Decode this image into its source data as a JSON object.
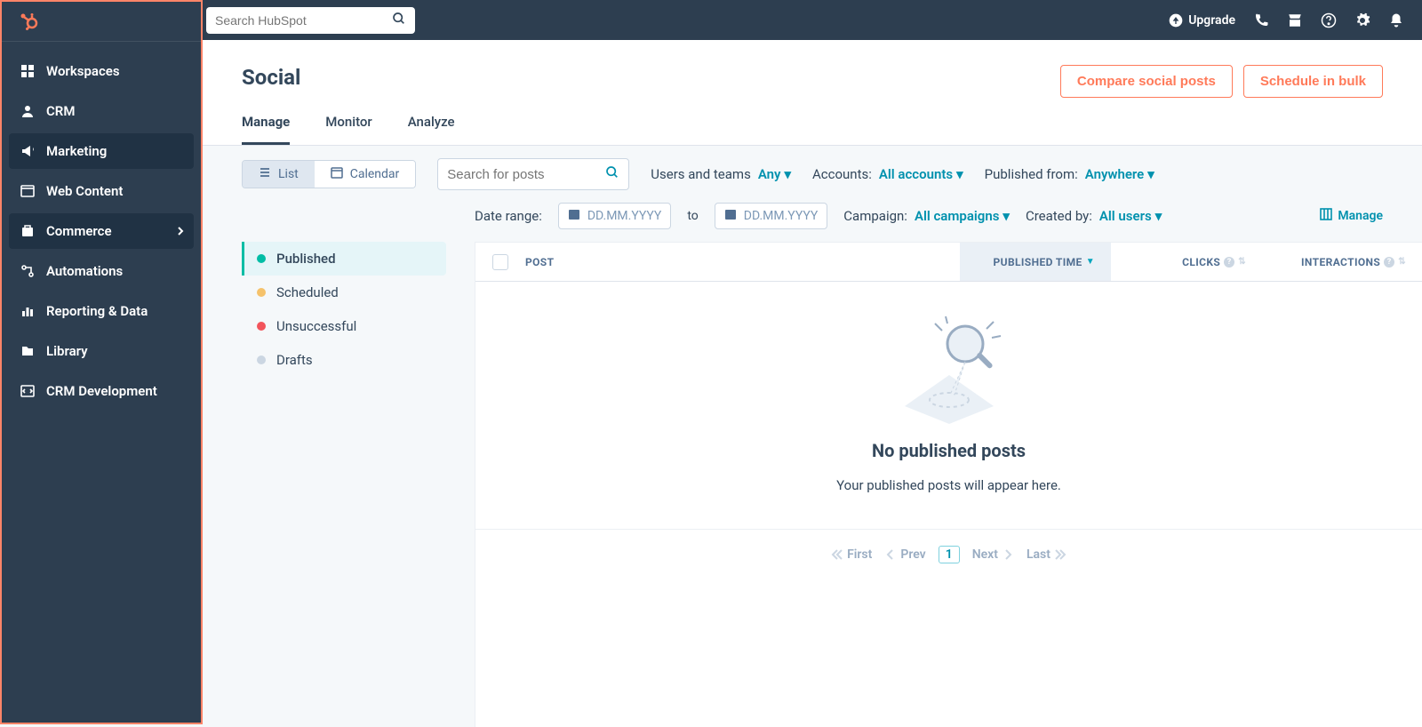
{
  "globalSearch": {
    "placeholder": "Search HubSpot"
  },
  "topbar": {
    "upgrade": "Upgrade"
  },
  "sidebar": {
    "items": [
      {
        "label": "Workspaces"
      },
      {
        "label": "CRM"
      },
      {
        "label": "Marketing"
      },
      {
        "label": "Web Content"
      },
      {
        "label": "Commerce"
      },
      {
        "label": "Automations"
      },
      {
        "label": "Reporting & Data"
      },
      {
        "label": "Library"
      },
      {
        "label": "CRM Development"
      }
    ]
  },
  "page": {
    "title": "Social",
    "compare_btn": "Compare social posts",
    "schedule_btn": "Schedule in bulk"
  },
  "tabs": {
    "manage": "Manage",
    "monitor": "Monitor",
    "analyze": "Analyze"
  },
  "viewToggle": {
    "list": "List",
    "calendar": "Calendar"
  },
  "postSearch": {
    "placeholder": "Search for posts"
  },
  "filters": {
    "users_label": "Users and teams",
    "users_val": "Any",
    "accounts_label": "Accounts:",
    "accounts_val": "All accounts",
    "published_label": "Published from:",
    "published_val": "Anywhere",
    "daterange_label": "Date range:",
    "date_placeholder": "DD.MM.YYYY",
    "to": "to",
    "campaign_label": "Campaign:",
    "campaign_val": "All campaigns",
    "createdby_label": "Created by:",
    "createdby_val": "All users",
    "manage_link": "Manage"
  },
  "statusList": {
    "published": "Published",
    "scheduled": "Scheduled",
    "unsuccessful": "Unsuccessful",
    "drafts": "Drafts"
  },
  "table": {
    "col_post": "POST",
    "col_pubtime": "PUBLISHED TIME",
    "col_clicks": "CLICKS",
    "col_inter": "INTERACTIONS"
  },
  "empty": {
    "title": "No published posts",
    "sub": "Your published posts will appear here."
  },
  "pager": {
    "first": "First",
    "prev": "Prev",
    "page": "1",
    "next": "Next",
    "last": "Last"
  }
}
